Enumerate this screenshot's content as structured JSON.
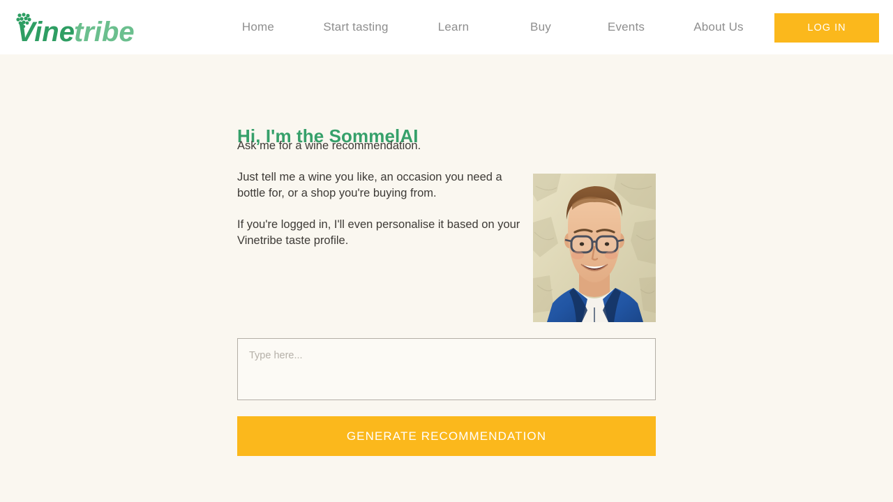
{
  "header": {
    "brand": {
      "name_part1": "Vine",
      "name_part2": "tribe",
      "icon": "grape-cluster-icon",
      "color_dark": "#2e9e63",
      "color_light": "#6bbf8e"
    },
    "nav": [
      {
        "label": "Home"
      },
      {
        "label": "Start tasting"
      },
      {
        "label": "Learn"
      },
      {
        "label": "Buy"
      },
      {
        "label": "Events"
      },
      {
        "label": "About Us"
      }
    ],
    "login_label": "LOG IN",
    "accent_color": "#fbb81c",
    "background": "#ffffff"
  },
  "main": {
    "title": "Hi, I'm the SommelAI",
    "title_color": "#36a06a",
    "paragraphs": [
      "Ask me for a wine recommendation.",
      "Just tell me a wine you like, an occasion you need a bottle for, or a shop you're buying from.",
      "If you're logged in, I'll even personalise it based on your Vinetribe taste profile."
    ],
    "portrait": {
      "alt": "sommelier-portrait-photo",
      "description": "Smiling man with glasses wearing a blue jacket in front of a beige stone wall"
    },
    "prompt": {
      "placeholder": "Type here...",
      "value": ""
    },
    "generate_label": "GENERATE RECOMMENDATION",
    "background": "#faf7f0"
  }
}
